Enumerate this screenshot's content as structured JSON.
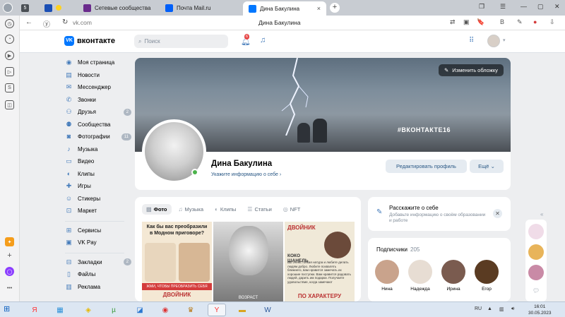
{
  "browser": {
    "tabs": [
      {
        "label": "",
        "color": "#4a4f55"
      },
      {
        "label": "",
        "color": "#1b4fb5"
      },
      {
        "label": "Сетевые сообщества",
        "color": "#6a2b8c"
      },
      {
        "label": "Почта Mail.ru",
        "color": "#005ff9"
      },
      {
        "label": "Дина Бакулина",
        "color": "#0077ff"
      }
    ],
    "tab_count_badge": "5",
    "url": "vk.com",
    "page_title": "Дина Бакулина"
  },
  "vk": {
    "logo_text": "вконтакте",
    "search_placeholder": "Поиск",
    "notifications_count": "6",
    "menu": [
      {
        "label": "Моя страница",
        "icon": "user-circle-icon"
      },
      {
        "label": "Новости",
        "icon": "news-icon"
      },
      {
        "label": "Мессенджер",
        "icon": "messenger-icon"
      },
      {
        "label": "Звонки",
        "icon": "phone-icon"
      },
      {
        "label": "Друзья",
        "icon": "friends-icon",
        "count": "2"
      },
      {
        "label": "Сообщества",
        "icon": "communities-icon"
      },
      {
        "label": "Фотографии",
        "icon": "photo-icon",
        "count": "11"
      },
      {
        "label": "Музыка",
        "icon": "music-icon"
      },
      {
        "label": "Видео",
        "icon": "video-icon"
      },
      {
        "label": "Клипы",
        "icon": "clips-icon"
      },
      {
        "label": "Игры",
        "icon": "games-icon"
      },
      {
        "label": "Стикеры",
        "icon": "stickers-icon"
      },
      {
        "label": "Маркет",
        "icon": "market-icon"
      }
    ],
    "menu2": [
      {
        "label": "Сервисы",
        "icon": "services-icon"
      },
      {
        "label": "VK Pay",
        "icon": "vkpay-icon"
      }
    ],
    "menu3": [
      {
        "label": "Закладки",
        "icon": "bookmark-icon",
        "count": "2"
      },
      {
        "label": "Файлы",
        "icon": "files-icon"
      },
      {
        "label": "Реклама",
        "icon": "ads-icon"
      }
    ],
    "cover": {
      "edit_label": "Изменить обложку",
      "hashtag": "#ВКОНТАКТЕ16"
    },
    "profile": {
      "name": "Дина Бакулина",
      "info_link": "Укажите информацию о себе",
      "edit_button": "Редактировать профиль",
      "more_button": "Ещё"
    },
    "media_tabs": [
      "Фото",
      "Музыка",
      "Клипы",
      "Статьи",
      "NFT"
    ],
    "photos": {
      "p1_title": "Как бы вас преобразили в Модном приговоре?",
      "p1_strip": "ЖМИ, ЧТОБЫ ПРЕОБРАЗИТЬ СЕБЯ",
      "p1_bottom": "ДВОЙНИК",
      "p2_label": "ВОЗРАСТ",
      "p3_title": "ДВОЙНИК",
      "p3_sub": "КОКО ШАНЕЛЬ",
      "p3_text": "Вы очень тонкая натура и любите делать людям добро. Любите похвалять ближнего, вам нравится замечать их хорошие поступки. Вам нравится радовать людей, дарить им подарки. Получаете удовольствие, когда замечают",
      "p3_bottom": "ПО ХАРАКТЕРУ"
    },
    "about": {
      "title": "Расскажите о себе",
      "subtitle": "Добавьте информацию о своём образовании и работе"
    },
    "subscribers": {
      "title": "Подписчики",
      "count": "205",
      "people": [
        "Нина",
        "Надежда",
        "Ирина",
        "Егор"
      ]
    }
  },
  "taskbar": {
    "lang": "RU",
    "time": "16:01",
    "date": "30.05.2023"
  }
}
